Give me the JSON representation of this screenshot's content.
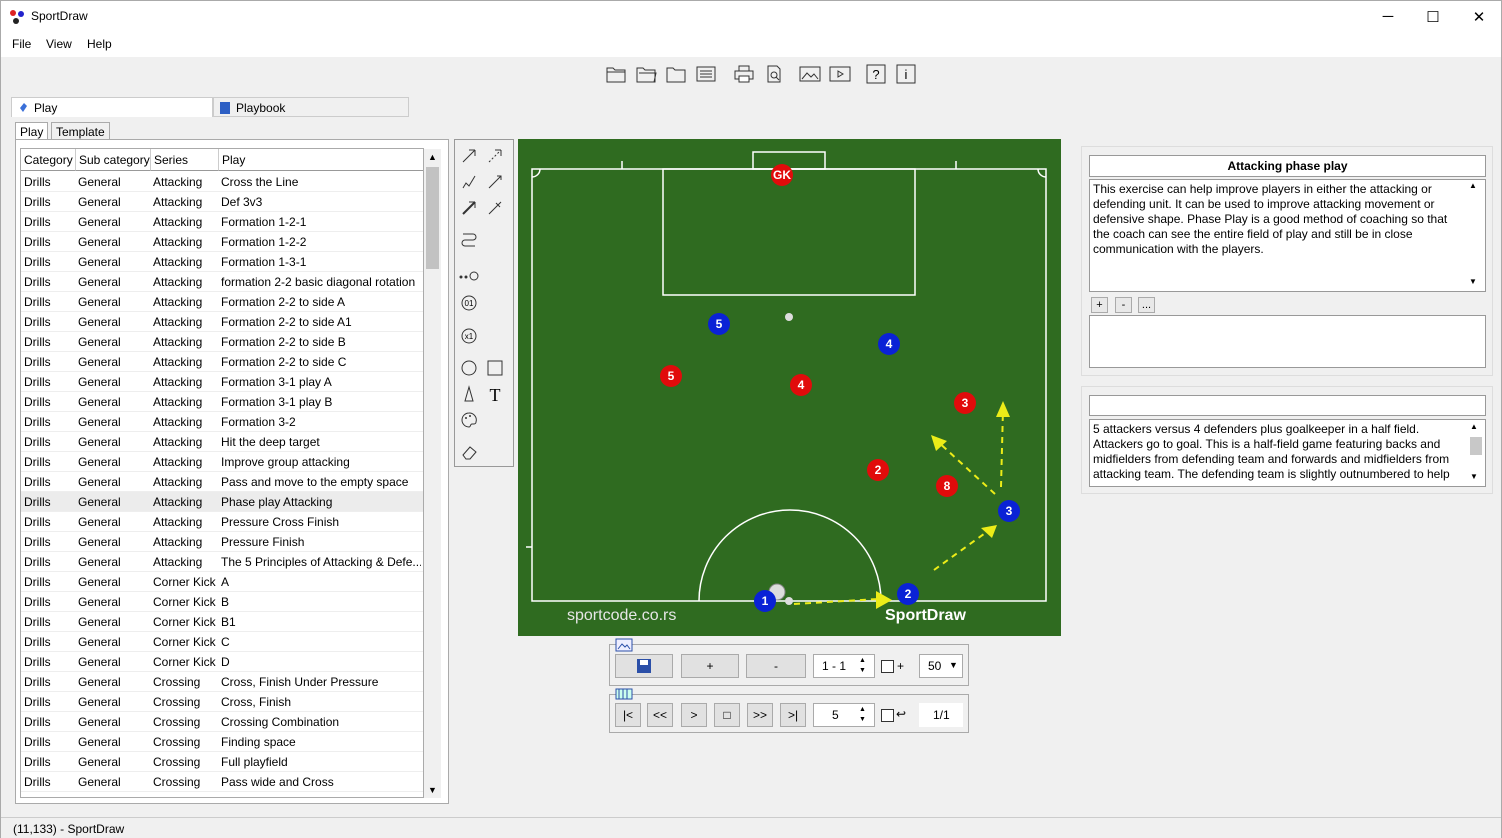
{
  "window": {
    "title": "SportDraw",
    "minimize": "─",
    "maximize": "☐",
    "close": "✕"
  },
  "menu": [
    "File",
    "View",
    "Help"
  ],
  "tabs": {
    "play": "Play",
    "playbook": "Playbook"
  },
  "subtabs": {
    "play": "Play",
    "template": "Template"
  },
  "table": {
    "headers": [
      "Category",
      "Sub category",
      "Series",
      "Play"
    ],
    "selected_index": 16,
    "rows": [
      [
        "Drills",
        "General",
        "Attacking",
        "Cross the Line"
      ],
      [
        "Drills",
        "General",
        "Attacking",
        "Def 3v3"
      ],
      [
        "Drills",
        "General",
        "Attacking",
        "Formation 1-2-1"
      ],
      [
        "Drills",
        "General",
        "Attacking",
        "Formation 1-2-2"
      ],
      [
        "Drills",
        "General",
        "Attacking",
        "Formation 1-3-1"
      ],
      [
        "Drills",
        "General",
        "Attacking",
        "formation 2-2 basic diagonal rotation"
      ],
      [
        "Drills",
        "General",
        "Attacking",
        "Formation 2-2 to side A"
      ],
      [
        "Drills",
        "General",
        "Attacking",
        "Formation 2-2 to side A1"
      ],
      [
        "Drills",
        "General",
        "Attacking",
        "Formation 2-2 to side B"
      ],
      [
        "Drills",
        "General",
        "Attacking",
        "Formation 2-2 to side C"
      ],
      [
        "Drills",
        "General",
        "Attacking",
        "Formation 3-1 play A"
      ],
      [
        "Drills",
        "General",
        "Attacking",
        "Formation 3-1 play B"
      ],
      [
        "Drills",
        "General",
        "Attacking",
        "Formation 3-2"
      ],
      [
        "Drills",
        "General",
        "Attacking",
        "Hit the deep target"
      ],
      [
        "Drills",
        "General",
        "Attacking",
        "Improve group attacking"
      ],
      [
        "Drills",
        "General",
        "Attacking",
        "Pass and move to the empty space"
      ],
      [
        "Drills",
        "General",
        "Attacking",
        "Phase play Attacking"
      ],
      [
        "Drills",
        "General",
        "Attacking",
        "Pressure Cross Finish"
      ],
      [
        "Drills",
        "General",
        "Attacking",
        "Pressure Finish"
      ],
      [
        "Drills",
        "General",
        "Attacking",
        "The 5 Principles of Attacking & Defe..."
      ],
      [
        "Drills",
        "General",
        "Corner Kick",
        "A"
      ],
      [
        "Drills",
        "General",
        "Corner Kick",
        "B"
      ],
      [
        "Drills",
        "General",
        "Corner Kick",
        "B1"
      ],
      [
        "Drills",
        "General",
        "Corner Kick",
        "C"
      ],
      [
        "Drills",
        "General",
        "Corner Kick",
        "D"
      ],
      [
        "Drills",
        "General",
        "Crossing",
        "Cross, Finish Under Pressure"
      ],
      [
        "Drills",
        "General",
        "Crossing",
        "Cross, Finish"
      ],
      [
        "Drills",
        "General",
        "Crossing",
        "Crossing Combination"
      ],
      [
        "Drills",
        "General",
        "Crossing",
        "Finding space"
      ],
      [
        "Drills",
        "General",
        "Crossing",
        "Full playfield"
      ],
      [
        "Drills",
        "General",
        "Crossing",
        "Pass wide and Cross"
      ]
    ]
  },
  "field": {
    "gk_label": "GK",
    "watermark_left": "sportcode.co.rs",
    "watermark_right": "SportDraw",
    "red_players": [
      "GK",
      "5",
      "4",
      "3",
      "2",
      "8"
    ],
    "blue_players": [
      "5",
      "4",
      "3",
      "2",
      "1"
    ]
  },
  "controls": {
    "plus": "+",
    "minus": "-",
    "frame": "1 - 1",
    "chk_plus_label": "+",
    "zoom": "50",
    "first": "|<",
    "prev_fast": "<<",
    "play": ">",
    "stop": "□",
    "next_fast": ">>",
    "last": ">|",
    "speed": "5",
    "loop_label": "↩",
    "page": "1/1"
  },
  "right_panel": {
    "title": "Attacking phase play",
    "description": "This exercise can help improve players in either the attacking or defending unit. It can be used to improve attacking movement or defensive shape. Phase Play is a good method of coaching so that the coach can see the entire field of play and still be in close communication with the players.",
    "btn_plus": "+",
    "btn_minus": "-",
    "btn_more": "...",
    "notes": "5 attackers versus 4 defenders plus goalkeeper in a half field. Attackers go to goal. This is a half-field game featuring backs and midfielders from defending team and forwards and midfielders from attacking team. The defending team is slightly outnumbered to help"
  },
  "status": "(11,133) - SportDraw"
}
